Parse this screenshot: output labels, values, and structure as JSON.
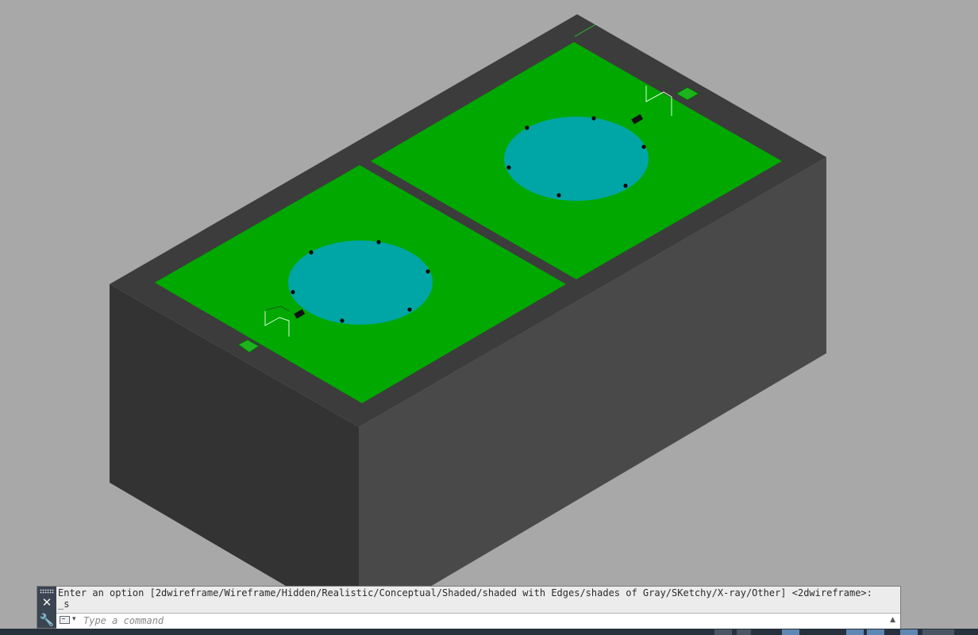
{
  "viewport": {
    "visual_style": "Shaded",
    "colors": {
      "background": "#a8a8a8",
      "slab_top": "#3c3c3c",
      "slab_left": "#333333",
      "slab_right": "#4a4a4a",
      "lawn": "#00a800",
      "pool": "#00a7a7"
    }
  },
  "command_line": {
    "history_line_1": "Enter an option [2dwireframe/Wireframe/Hidden/Realistic/Conceptual/Shaded/shaded with Edges/shades of Gray/SKetchy/X-ray/Other] <2dwireframe>:",
    "history_line_2": "_s",
    "input_placeholder": "Type a command",
    "input_value": "",
    "icons": {
      "grip": "grip-dots-icon",
      "close": "close-icon",
      "customize": "wrench-icon",
      "recent_commands": "command-prompt-icon",
      "expand_history": "caret-up-icon"
    },
    "close_glyph": "✕",
    "wrench_glyph": "🔧",
    "caret_glyph": "▾",
    "expand_glyph": "▲"
  }
}
